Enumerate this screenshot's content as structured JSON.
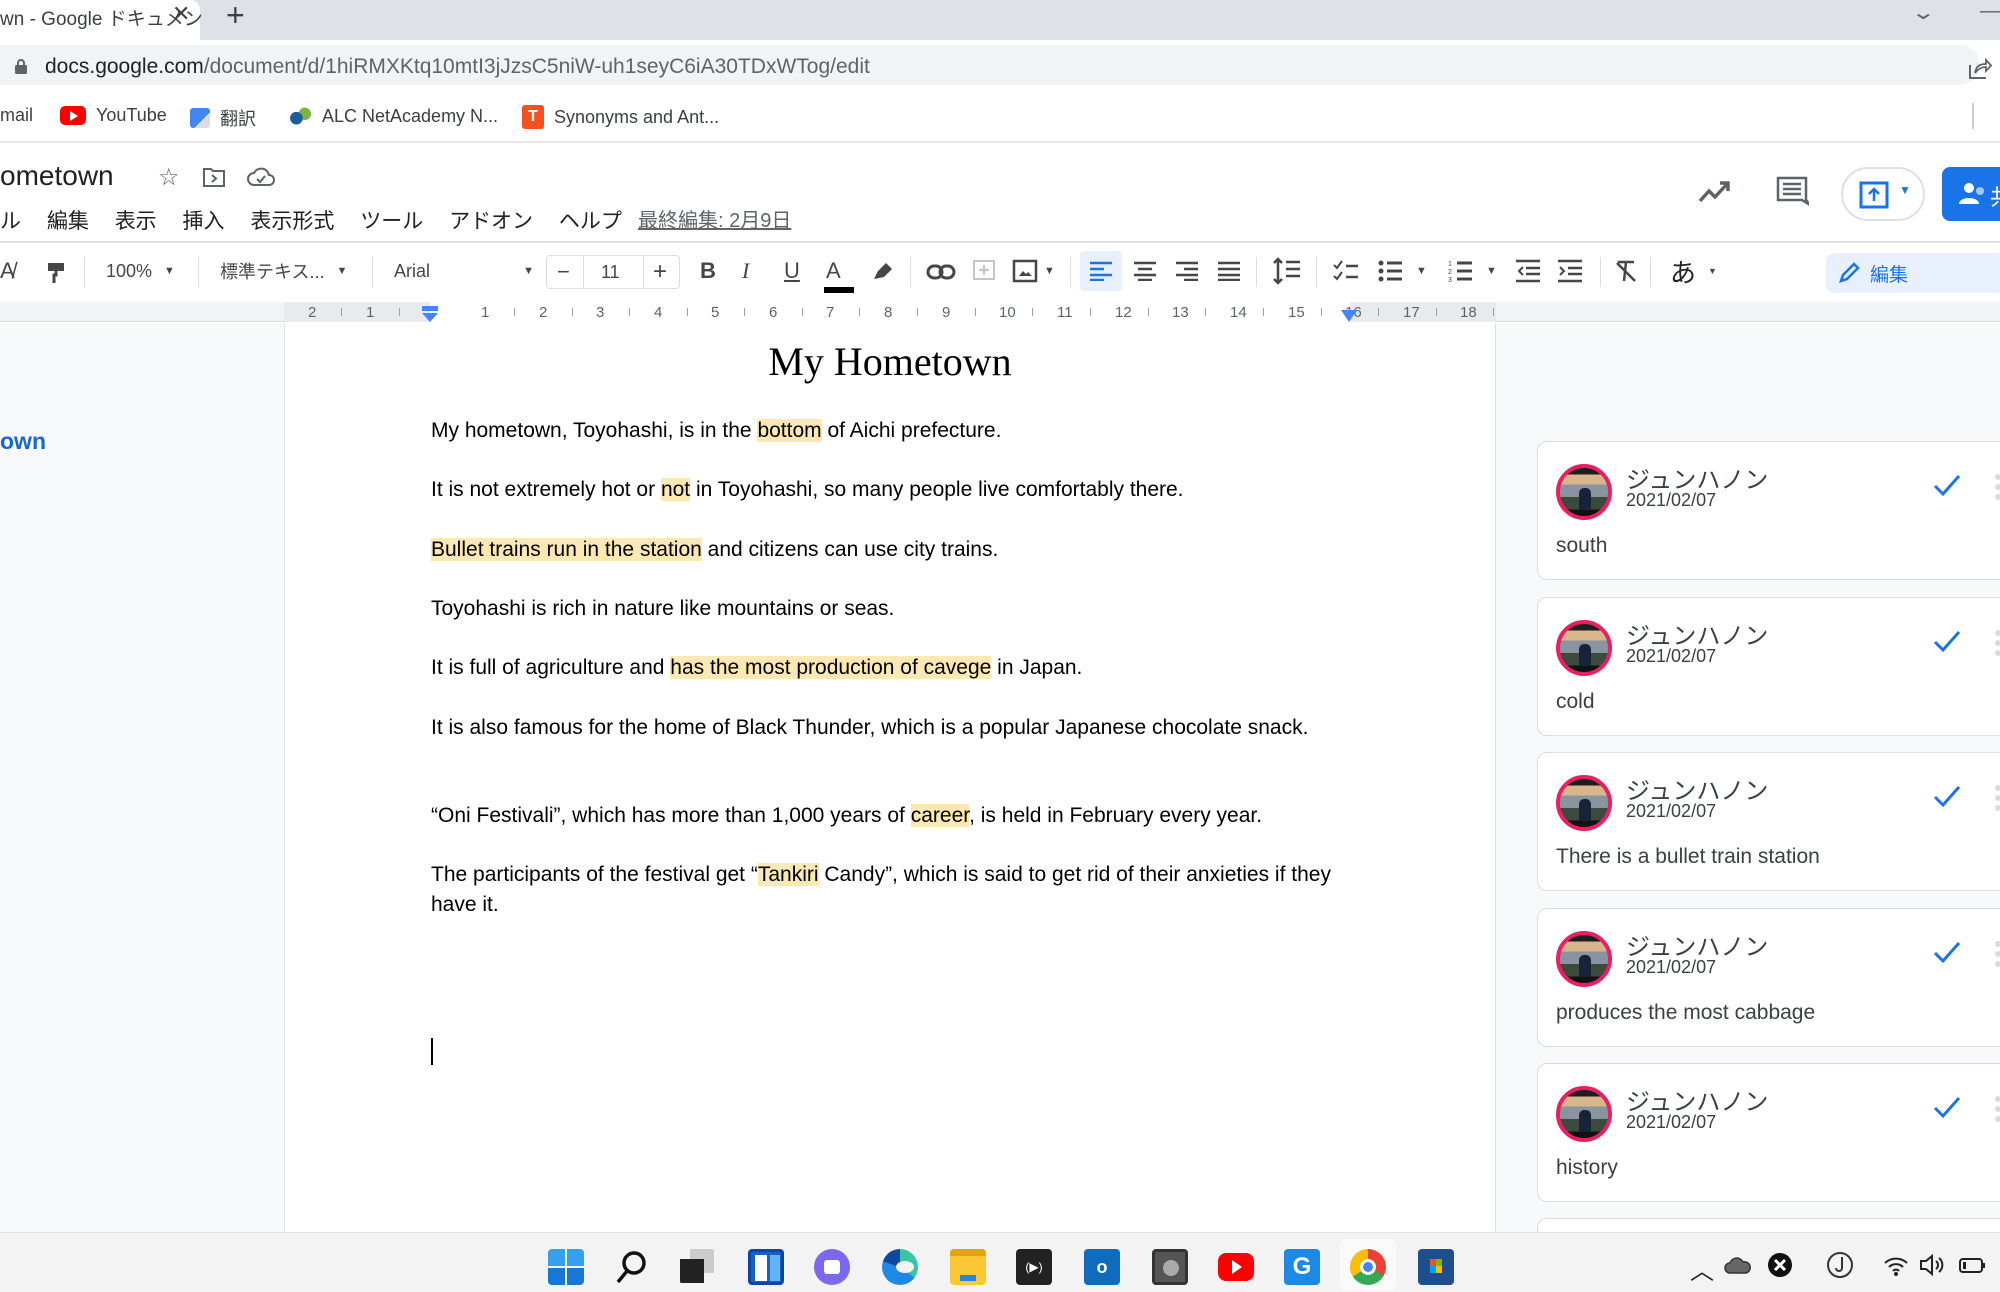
{
  "browser": {
    "tab_title": "wn - Google ドキュメン",
    "tab_close": "✕",
    "new_tab": "+",
    "url_host": "docs.google.com",
    "url_path": "/document/d/1hiRMXKtq10mtI3jJzsC5niW-uh1seyC6iA30TDxWTog/edit",
    "bookmarks": [
      {
        "label": "mail",
        "icon": "gmail-icon"
      },
      {
        "label": "YouTube",
        "icon": "youtube-icon"
      },
      {
        "label": "翻訳",
        "icon": "google-translate-icon"
      },
      {
        "label": "ALC NetAcademy N...",
        "icon": "alc-icon"
      },
      {
        "label": "Synonyms and Ant...",
        "icon": "thesaurus-icon"
      }
    ]
  },
  "docs": {
    "title": "ometown",
    "menu": [
      "ル",
      "編集",
      "表示",
      "挿入",
      "表示形式",
      "ツール",
      "アドオン",
      "ヘルプ"
    ],
    "last_edit": "最終編集: 2月9日",
    "share_label": "共",
    "toolbar": {
      "zoom": "100%",
      "style": "標準テキス...",
      "font": "Arial",
      "font_size": "11",
      "minus": "−",
      "plus": "+",
      "bold": "B",
      "italic": "I",
      "underline": "U",
      "text_color": "A",
      "input_tools": "あ",
      "mode": "編集"
    },
    "ruler_ticks": [
      "2",
      "1",
      "1",
      "2",
      "3",
      "4",
      "5",
      "6",
      "7",
      "8",
      "9",
      "10",
      "11",
      "12",
      "13",
      "14",
      "15",
      "16",
      "17",
      "18"
    ],
    "outline_item": "own"
  },
  "document": {
    "heading": "My Hometown",
    "paragraphs": [
      {
        "pre": "My hometown, Toyohashi, is in the ",
        "hl": "bottom",
        "post": " of Aichi prefecture."
      },
      {
        "pre": "It is not extremely hot or ",
        "hl": "not",
        "post": " in Toyohashi, so many people live comfortably there."
      },
      {
        "pre": "",
        "hl": "Bullet trains run in the station",
        "post": " and citizens can use city trains."
      },
      {
        "pre": "Toyohashi is rich in nature like mountains or seas.",
        "hl": "",
        "post": ""
      },
      {
        "pre": "It is full of agriculture and ",
        "hl": "has the most production of cavege",
        "post": " in Japan."
      },
      {
        "pre": "It is also famous for the home of Black Thunder, which is a popular Japanese chocolate snack.",
        "hl": "",
        "post": ""
      },
      {
        "pre": "“Oni Festivali”, which has more than 1,000 years of ",
        "hl": "career",
        "post": ", is held in February every year."
      },
      {
        "pre": "The participants of the festival get “",
        "hl": "Tankiri",
        "post": " Candy”, which is said to get rid of their anxieties if they have it."
      }
    ]
  },
  "comments": [
    {
      "author": "ジュンハノン",
      "date": "2021/02/07",
      "text": "south"
    },
    {
      "author": "ジュンハノン",
      "date": "2021/02/07",
      "text": "cold"
    },
    {
      "author": "ジュンハノン",
      "date": "2021/02/07",
      "text": "There is a bullet train station"
    },
    {
      "author": "ジュンハノン",
      "date": "2021/02/07",
      "text": "produces the most cabbage"
    },
    {
      "author": "ジュンハノン",
      "date": "2021/02/07",
      "text": "history"
    }
  ],
  "colors": {
    "accent": "#1a73e8",
    "highlight": "#fce8b2",
    "avatar_ring": "#e91e63"
  },
  "taskbar": {
    "apps": [
      "start",
      "search",
      "task-view",
      "widgets",
      "teams-chat",
      "edge",
      "file-explorer",
      "media-app",
      "outlook",
      "settings-app",
      "youtube",
      "google",
      "chrome",
      "store"
    ]
  }
}
